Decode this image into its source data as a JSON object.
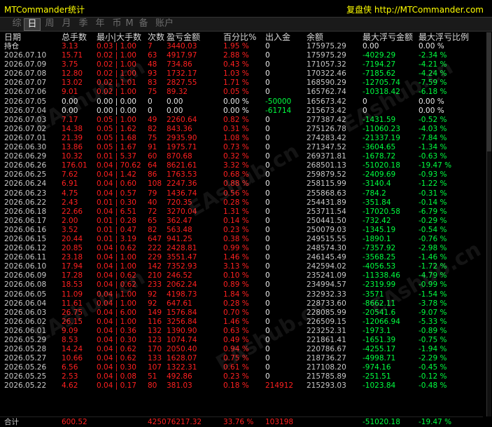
{
  "app": {
    "title": "MTCommander统计",
    "brand": "复盘侠 http://MTCommander.com"
  },
  "tabs": [
    {
      "label": "综",
      "active": false
    },
    {
      "label": "日",
      "active": true
    },
    {
      "label": "周",
      "active": false
    },
    {
      "label": "月",
      "active": false
    },
    {
      "label": "季",
      "active": false
    },
    {
      "label": "年",
      "active": false
    },
    {
      "label": "币",
      "active": false
    },
    {
      "label": "M",
      "active": false
    },
    {
      "label": "备",
      "active": false
    },
    {
      "label": "账户",
      "active": false
    }
  ],
  "columns": [
    "日期",
    "总手数",
    "最小|大手数",
    "次数",
    "盈亏金额",
    "百分比%",
    "出入金",
    "余额",
    "最大浮亏金额",
    "最大浮亏比例"
  ],
  "rows": [
    {
      "date": "持仓",
      "lots": "3.13",
      "minmax": "0.03 | 1.00",
      "count": "7",
      "pnl": "3440.03",
      "pct": "1.95 %",
      "io": "0",
      "balance": "175975.29",
      "fl": "0.00",
      "flp": "0.00 %",
      "kind": "red"
    },
    {
      "date": "2026.07.10",
      "lots": "15.71",
      "minmax": "0.02 | 1.00",
      "count": "63",
      "pnl": "4917.97",
      "pct": "2.88 %",
      "io": "0",
      "balance": "175975.29",
      "fl": "-4029.29",
      "flp": "-2.34 %",
      "kind": "red"
    },
    {
      "date": "2026.07.09",
      "lots": "3.75",
      "minmax": "0.02 | 1.00",
      "count": "48",
      "pnl": "734.86",
      "pct": "0.43 %",
      "io": "0",
      "balance": "171057.32",
      "fl": "-7194.27",
      "flp": "-4.21 %",
      "kind": "red"
    },
    {
      "date": "2026.07.08",
      "lots": "12.80",
      "minmax": "0.02 | 1.00",
      "count": "93",
      "pnl": "1732.17",
      "pct": "1.03 %",
      "io": "0",
      "balance": "170322.46",
      "fl": "-7185.62",
      "flp": "-4.24 %",
      "kind": "red"
    },
    {
      "date": "2026.07.07",
      "lots": "13.02",
      "minmax": "0.02 | 1.01",
      "count": "83",
      "pnl": "2827.55",
      "pct": "1.71 %",
      "io": "0",
      "balance": "168590.29",
      "fl": "-12705.74",
      "flp": "-7.59 %",
      "kind": "red"
    },
    {
      "date": "2026.07.06",
      "lots": "9.01",
      "minmax": "0.02 | 1.00",
      "count": "75",
      "pnl": "89.32",
      "pct": "0.05 %",
      "io": "0",
      "balance": "165762.74",
      "fl": "-10318.42",
      "flp": "-6.18 %",
      "kind": "red"
    },
    {
      "date": "2026.07.05",
      "lots": "0.00",
      "minmax": "0.00 | 0.00",
      "count": "0",
      "pnl": "0.00",
      "pct": "0.00 %",
      "io": "-50000",
      "balance": "165673.42",
      "fl": "0",
      "flp": "0.00 %",
      "kind": "white"
    },
    {
      "date": "2026.07.04",
      "lots": "0.00",
      "minmax": "0.00 | 0.00",
      "count": "0",
      "pnl": "0.00",
      "pct": "0.00 %",
      "io": "-61714",
      "balance": "215673.42",
      "fl": "0",
      "flp": "0.00 %",
      "kind": "white"
    },
    {
      "date": "2026.07.03",
      "lots": "7.17",
      "minmax": "0.05 | 1.00",
      "count": "49",
      "pnl": "2260.64",
      "pct": "0.82 %",
      "io": "0",
      "balance": "277387.42",
      "fl": "-1431.59",
      "flp": "-0.52 %",
      "kind": "red"
    },
    {
      "date": "2026.07.02",
      "lots": "14.38",
      "minmax": "0.05 | 1.62",
      "count": "82",
      "pnl": "843.36",
      "pct": "0.31 %",
      "io": "0",
      "balance": "275126.78",
      "fl": "-11060.23",
      "flp": "-4.03 %",
      "kind": "red"
    },
    {
      "date": "2026.07.01",
      "lots": "21.39",
      "minmax": "0.05 | 1.68",
      "count": "75",
      "pnl": "2935.90",
      "pct": "1.08 %",
      "io": "0",
      "balance": "274283.42",
      "fl": "-21337.19",
      "flp": "-7.84 %",
      "kind": "red"
    },
    {
      "date": "2026.06.30",
      "lots": "13.86",
      "minmax": "0.05 | 1.67",
      "count": "91",
      "pnl": "1975.71",
      "pct": "0.73 %",
      "io": "0",
      "balance": "271347.52",
      "fl": "-3604.65",
      "flp": "-1.34 %",
      "kind": "red"
    },
    {
      "date": "2026.06.29",
      "lots": "10.32",
      "minmax": "0.01 | 5.37",
      "count": "60",
      "pnl": "870.68",
      "pct": "0.32 %",
      "io": "0",
      "balance": "269371.81",
      "fl": "-1678.72",
      "flp": "-0.63 %",
      "kind": "red"
    },
    {
      "date": "2026.06.26",
      "lots": "176.01",
      "minmax": "0.04 | 70.62",
      "count": "64",
      "pnl": "8621.61",
      "pct": "3.32 %",
      "io": "0",
      "balance": "268501.13",
      "fl": "-51020.18",
      "flp": "-19.47 %",
      "kind": "red"
    },
    {
      "date": "2026.06.25",
      "lots": "7.62",
      "minmax": "0.04 | 1.42",
      "count": "86",
      "pnl": "1763.53",
      "pct": "0.68 %",
      "io": "0",
      "balance": "259879.52",
      "fl": "-2409.69",
      "flp": "-0.93 %",
      "kind": "red"
    },
    {
      "date": "2026.06.24",
      "lots": "6.91",
      "minmax": "0.04 | 0.60",
      "count": "108",
      "pnl": "2247.36",
      "pct": "0.88 %",
      "io": "0",
      "balance": "258115.99",
      "fl": "-3140.4",
      "flp": "-1.22 %",
      "kind": "red"
    },
    {
      "date": "2026.06.23",
      "lots": "4.75",
      "minmax": "0.04 | 0.57",
      "count": "79",
      "pnl": "1436.74",
      "pct": "0.56 %",
      "io": "0",
      "balance": "255868.63",
      "fl": "-784.2",
      "flp": "-0.31 %",
      "kind": "red"
    },
    {
      "date": "2026.06.22",
      "lots": "2.43",
      "minmax": "0.01 | 0.30",
      "count": "40",
      "pnl": "720.35",
      "pct": "0.28 %",
      "io": "0",
      "balance": "254431.89",
      "fl": "-351.84",
      "flp": "-0.14 %",
      "kind": "red"
    },
    {
      "date": "2026.06.18",
      "lots": "22.66",
      "minmax": "0.04 | 6.51",
      "count": "72",
      "pnl": "3270.04",
      "pct": "1.31 %",
      "io": "0",
      "balance": "253711.54",
      "fl": "-17020.58",
      "flp": "-6.79 %",
      "kind": "red"
    },
    {
      "date": "2026.06.17",
      "lots": "2.00",
      "minmax": "0.01 | 0.28",
      "count": "65",
      "pnl": "362.47",
      "pct": "0.14 %",
      "io": "0",
      "balance": "250441.50",
      "fl": "-732.42",
      "flp": "-0.29 %",
      "kind": "red"
    },
    {
      "date": "2026.06.16",
      "lots": "3.52",
      "minmax": "0.01 | 0.47",
      "count": "82",
      "pnl": "563.48",
      "pct": "0.23 %",
      "io": "0",
      "balance": "250079.03",
      "fl": "-1345.19",
      "flp": "-0.54 %",
      "kind": "red"
    },
    {
      "date": "2026.06.15",
      "lots": "20.44",
      "minmax": "0.01 | 3.19",
      "count": "647",
      "pnl": "941.25",
      "pct": "0.38 %",
      "io": "0",
      "balance": "249515.55",
      "fl": "-1890.1",
      "flp": "-0.76 %",
      "kind": "red"
    },
    {
      "date": "2026.06.12",
      "lots": "20.85",
      "minmax": "0.04 | 0.62",
      "count": "222",
      "pnl": "2428.81",
      "pct": "0.99 %",
      "io": "0",
      "balance": "248574.30",
      "fl": "-7357.92",
      "flp": "-2.98 %",
      "kind": "red"
    },
    {
      "date": "2026.06.11",
      "lots": "23.18",
      "minmax": "0.04 | 1.00",
      "count": "229",
      "pnl": "3551.47",
      "pct": "1.46 %",
      "io": "0",
      "balance": "246145.49",
      "fl": "-3568.25",
      "flp": "-1.46 %",
      "kind": "red"
    },
    {
      "date": "2026.06.10",
      "lots": "17.94",
      "minmax": "0.04 | 1.00",
      "count": "142",
      "pnl": "7352.93",
      "pct": "3.13 %",
      "io": "0",
      "balance": "242594.02",
      "fl": "-4056.53",
      "flp": "-1.72 %",
      "kind": "red"
    },
    {
      "date": "2026.06.09",
      "lots": "17.28",
      "minmax": "0.04 | 0.62",
      "count": "210",
      "pnl": "246.52",
      "pct": "0.10 %",
      "io": "0",
      "balance": "235241.09",
      "fl": "-11338.46",
      "flp": "-4.79 %",
      "kind": "red"
    },
    {
      "date": "2026.06.08",
      "lots": "18.53",
      "minmax": "0.04 | 0.62",
      "count": "233",
      "pnl": "2062.24",
      "pct": "0.89 %",
      "io": "0",
      "balance": "234994.57",
      "fl": "-2319.99",
      "flp": "-0.99 %",
      "kind": "red"
    },
    {
      "date": "2026.06.05",
      "lots": "11.09",
      "minmax": "0.04 | 1.00",
      "count": "92",
      "pnl": "4198.73",
      "pct": "1.84 %",
      "io": "0",
      "balance": "232932.33",
      "fl": "-3571",
      "flp": "-1.54 %",
      "kind": "red"
    },
    {
      "date": "2026.06.04",
      "lots": "11.61",
      "minmax": "0.04 | 1.00",
      "count": "92",
      "pnl": "647.61",
      "pct": "0.28 %",
      "io": "0",
      "balance": "228733.60",
      "fl": "-8662.11",
      "flp": "-3.78 %",
      "kind": "red"
    },
    {
      "date": "2026.06.03",
      "lots": "26.75",
      "minmax": "0.04 | 6.00",
      "count": "149",
      "pnl": "1576.84",
      "pct": "0.70 %",
      "io": "0",
      "balance": "228085.99",
      "fl": "-20541.6",
      "flp": "-9.07 %",
      "kind": "red"
    },
    {
      "date": "2026.06.02",
      "lots": "26.15",
      "minmax": "0.04 | 1.00",
      "count": "116",
      "pnl": "3256.84",
      "pct": "1.46 %",
      "io": "0",
      "balance": "226509.15",
      "fl": "-12066.94",
      "flp": "-5.33 %",
      "kind": "red"
    },
    {
      "date": "2026.06.01",
      "lots": "9.09",
      "minmax": "0.04 | 0.36",
      "count": "132",
      "pnl": "1390.90",
      "pct": "0.63 %",
      "io": "0",
      "balance": "223252.31",
      "fl": "-1973.1",
      "flp": "-0.89 %",
      "kind": "red"
    },
    {
      "date": "2026.05.29",
      "lots": "8.53",
      "minmax": "0.04 | 0.30",
      "count": "123",
      "pnl": "1074.74",
      "pct": "0.49 %",
      "io": "0",
      "balance": "221861.41",
      "fl": "-1651.39",
      "flp": "-0.75 %",
      "kind": "red"
    },
    {
      "date": "2026.05.28",
      "lots": "14.24",
      "minmax": "0.04 | 0.62",
      "count": "170",
      "pnl": "2050.40",
      "pct": "0.94 %",
      "io": "0",
      "balance": "220786.67",
      "fl": "-4255.17",
      "flp": "-1.94 %",
      "kind": "red"
    },
    {
      "date": "2026.05.27",
      "lots": "10.66",
      "minmax": "0.04 | 0.62",
      "count": "133",
      "pnl": "1628.07",
      "pct": "0.75 %",
      "io": "0",
      "balance": "218736.27",
      "fl": "-4998.71",
      "flp": "-2.29 %",
      "kind": "red"
    },
    {
      "date": "2026.05.26",
      "lots": "6.56",
      "minmax": "0.04 | 0.30",
      "count": "107",
      "pnl": "1322.31",
      "pct": "0.61 %",
      "io": "0",
      "balance": "217108.20",
      "fl": "-974.16",
      "flp": "-0.45 %",
      "kind": "red"
    },
    {
      "date": "2026.05.25",
      "lots": "2.53",
      "minmax": "0.04 | 0.08",
      "count": "51",
      "pnl": "492.86",
      "pct": "0.23 %",
      "io": "0",
      "balance": "215785.89",
      "fl": "-251.51",
      "flp": "-0.12 %",
      "kind": "red"
    },
    {
      "date": "2026.05.22",
      "lots": "4.62",
      "minmax": "0.04 | 0.17",
      "count": "80",
      "pnl": "381.03",
      "pct": "0.18 %",
      "io": "214912",
      "balance": "215293.03",
      "fl": "-1023.84",
      "flp": "-0.48 %",
      "kind": "red"
    }
  ],
  "total": {
    "label": "合计",
    "lots": "600.52",
    "count": "4250",
    "pnl": "76217.32",
    "pct": "33.76 %",
    "io": "103198",
    "fl": "-51020.18",
    "flp": "-19.47 %"
  }
}
